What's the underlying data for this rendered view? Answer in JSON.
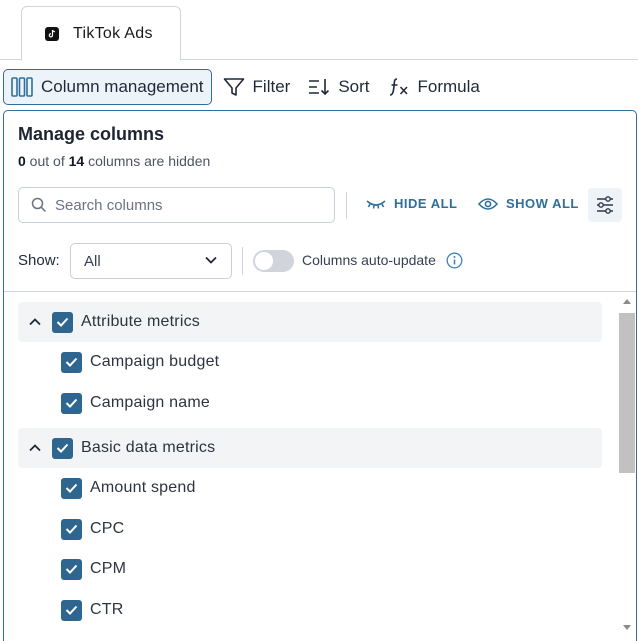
{
  "tab": {
    "label": "TikTok Ads",
    "icon": "tiktok-icon"
  },
  "toolbar": {
    "column_management": "Column management",
    "filter": "Filter",
    "sort": "Sort",
    "formula": "Formula"
  },
  "panel": {
    "title": "Manage columns",
    "hidden_count": "0",
    "hidden_mid": " out of ",
    "total_count": "14",
    "hidden_suffix": " columns are hidden",
    "search_placeholder": "Search columns",
    "hide_all": "HIDE ALL",
    "show_all": "SHOW ALL",
    "show_label": "Show:",
    "show_value": "All",
    "auto_update_label": "Columns auto-update",
    "auto_update_enabled": false
  },
  "groups": [
    {
      "label": "Attribute metrics",
      "checked": true,
      "items": [
        {
          "label": "Campaign budget",
          "checked": true
        },
        {
          "label": "Campaign name",
          "checked": true
        }
      ]
    },
    {
      "label": "Basic data metrics",
      "checked": true,
      "items": [
        {
          "label": "Amount spend",
          "checked": true
        },
        {
          "label": "CPC",
          "checked": true
        },
        {
          "label": "CPM",
          "checked": true
        },
        {
          "label": "CTR",
          "checked": true
        }
      ]
    }
  ],
  "colors": {
    "accent": "#2f6f98",
    "checkbox": "#2f6690"
  }
}
